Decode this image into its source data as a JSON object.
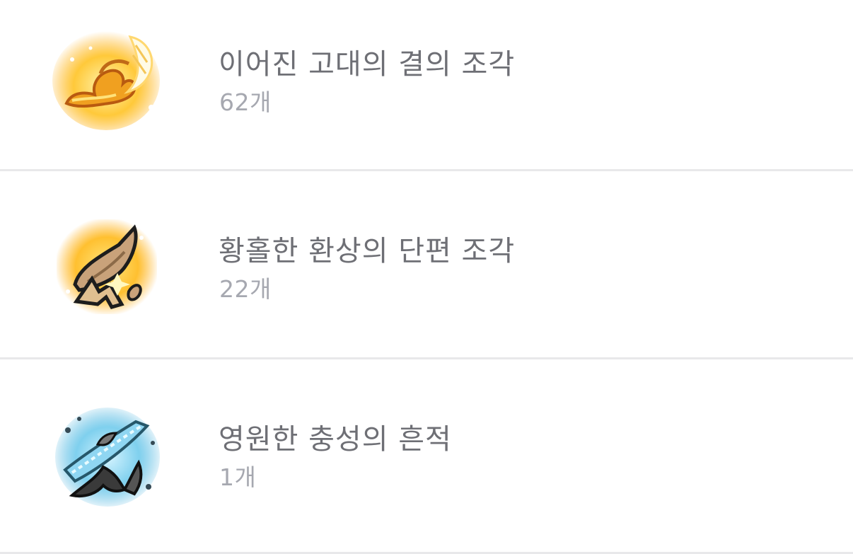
{
  "items": [
    {
      "name": "이어진 고대의 결의 조각",
      "count": "62개",
      "icon": "golden-feather-fragment-icon"
    },
    {
      "name": "황홀한 환상의 단편 조각",
      "count": "22개",
      "icon": "golden-shard-fragment-icon"
    },
    {
      "name": "영원한 충성의 흔적",
      "count": "1개",
      "icon": "blue-crystal-blade-icon"
    }
  ]
}
